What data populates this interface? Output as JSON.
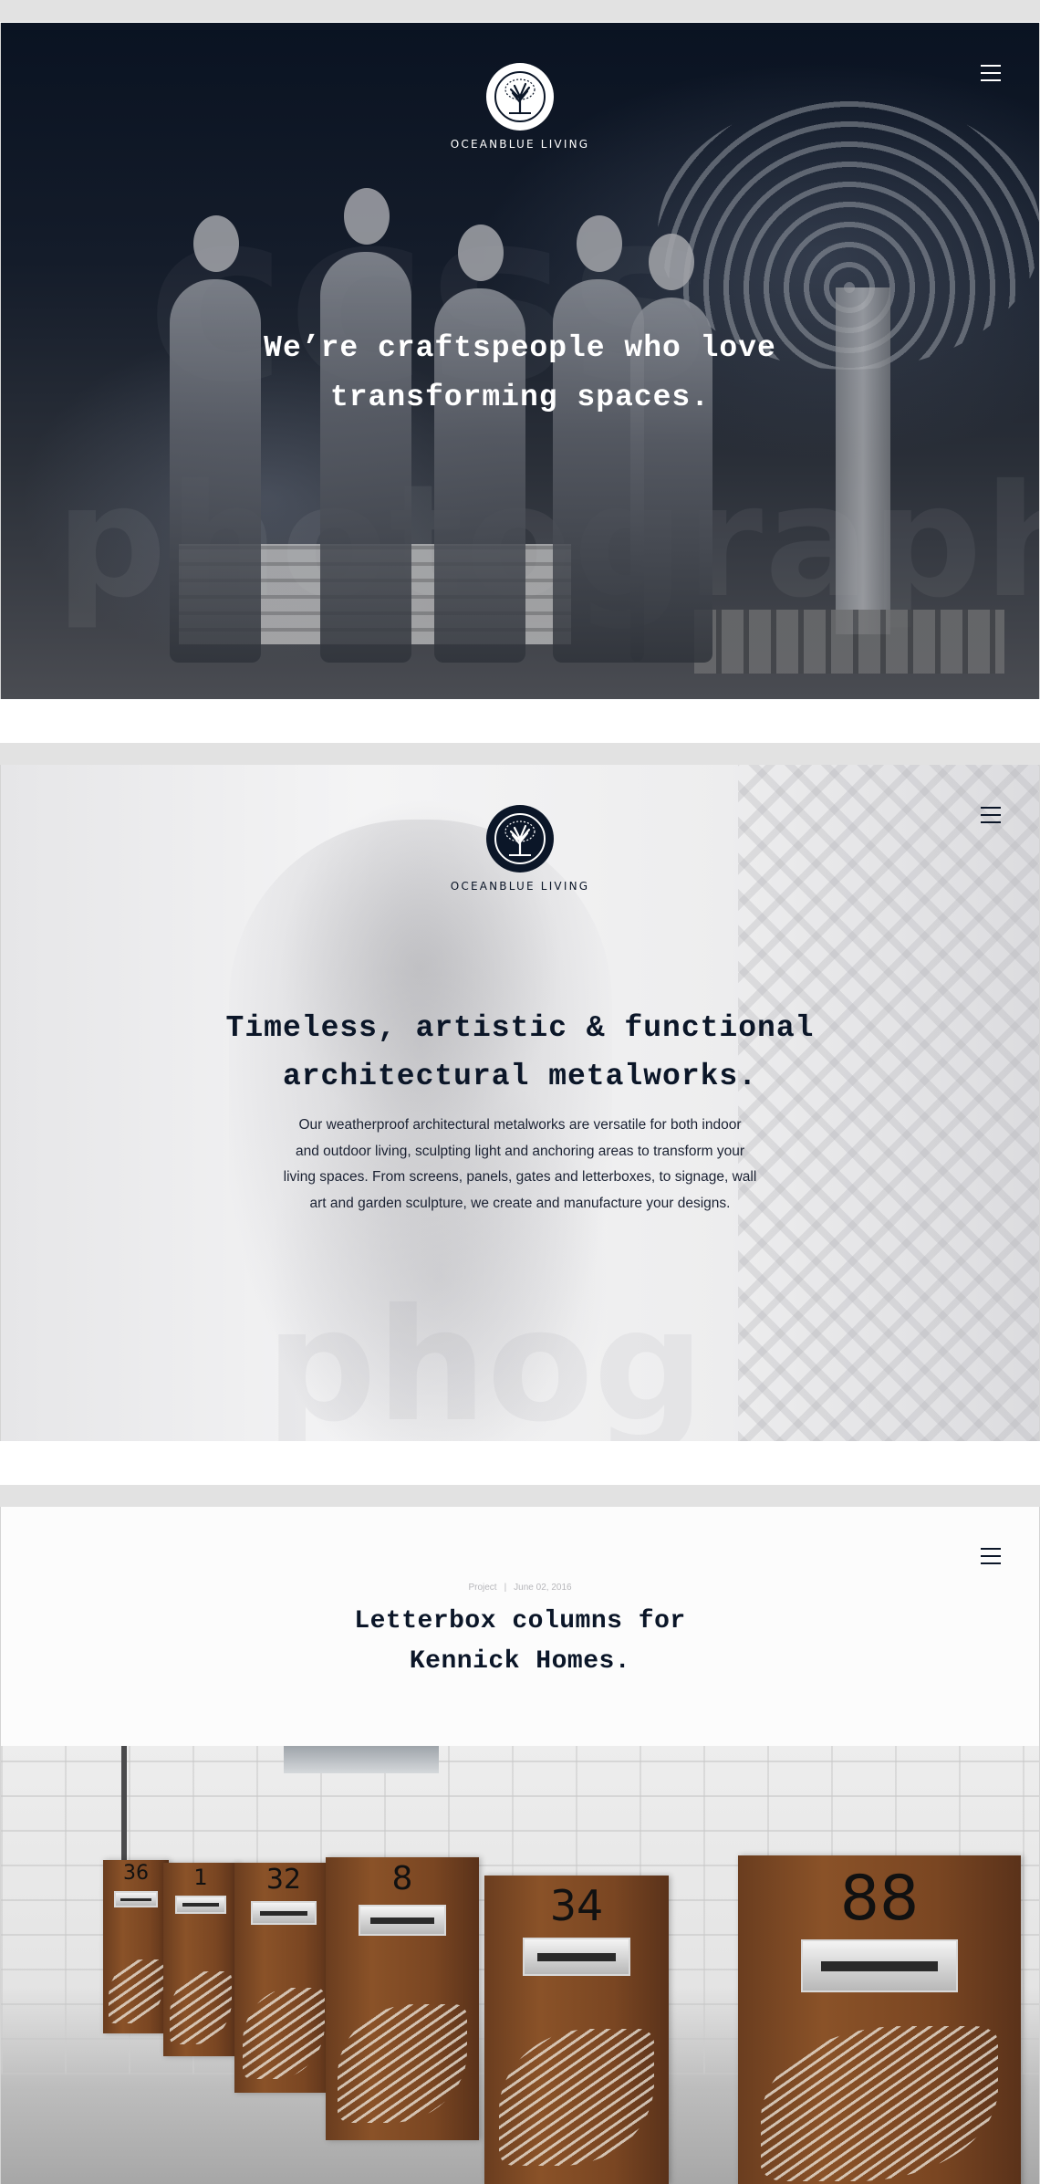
{
  "brand": {
    "name": "OCEANBLUE LIVING",
    "navy": "#0b1628",
    "white": "#ffffff"
  },
  "panel1": {
    "logo_text": "OCEANBLUE LIVING",
    "title_line1": "We’re craftspeople who love",
    "title_line2": "transforming spaces.",
    "watermark": "photography",
    "menu_icon": "hamburger-menu-icon"
  },
  "panel2": {
    "logo_text": "OCEANBLUE LIVING",
    "title_line1": "Timeless, artistic & functional",
    "title_line2": "architectural metalworks.",
    "body_lines": [
      "Our weatherproof architectural metalworks are versatile for both indoor",
      "and outdoor living, sculpting light and anchoring areas to transform your",
      "living spaces. From screens, panels, gates and letterboxes, to signage, wall",
      "art and garden sculpture, we create and manufacture your designs."
    ],
    "menu_icon": "hamburger-menu-icon"
  },
  "panel3": {
    "meta_category": "Project",
    "meta_separator": "|",
    "meta_date": "June 02, 2016",
    "title_line1": "Letterbox columns for",
    "title_line2": "Kennick Homes.",
    "menu_icon": "hamburger-menu-icon",
    "letterbox_numbers": [
      "36",
      "1",
      "32",
      "8",
      "34",
      "88"
    ],
    "corten_color": "#7a4622"
  }
}
